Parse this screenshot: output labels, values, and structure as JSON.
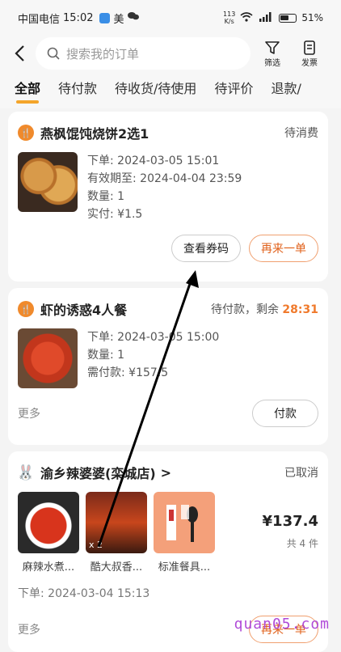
{
  "status_bar": {
    "carrier": "中国电信",
    "time": "15:02",
    "app_badge": "美",
    "net_speed_top": "113",
    "net_speed_bottom": "K/s",
    "battery": "51%"
  },
  "header": {
    "search_placeholder": "搜索我的订单",
    "filter_label": "筛选",
    "invoice_label": "发票"
  },
  "tabs": [
    {
      "label": "全部",
      "active": true
    },
    {
      "label": "待付款"
    },
    {
      "label": "待收货/待使用"
    },
    {
      "label": "待评价"
    },
    {
      "label": "退款/"
    }
  ],
  "orders": [
    {
      "shop": "燕枫馄饨烧饼2选1",
      "status": "待消费",
      "lines": [
        "下单: 2024-03-05 15:01",
        "有效期至: 2024-04-04 23:59",
        "数量: 1",
        "实付: ¥1.5"
      ],
      "buttons": [
        "查看券码",
        "再来一单"
      ]
    },
    {
      "shop": "虾的诱惑4人餐",
      "status_prefix": "待付款，剩余 ",
      "countdown": "28:31",
      "lines": [
        "下单: 2024-03-05 15:00",
        "数量: 1",
        "需付款: ¥157.5"
      ],
      "more": "更多",
      "buttons": [
        "付款"
      ]
    },
    {
      "shop": "渝乡辣婆婆(栾城店)",
      "chevron": ">",
      "status": "已取消",
      "items": [
        {
          "name": "麻辣水煮...",
          "qty": ""
        },
        {
          "name": "酷大叔香...",
          "qty": "x 2"
        },
        {
          "name": "标准餐具..."
        }
      ],
      "price": "¥137.4",
      "count": "共 4 件",
      "order_time": "下单: 2024-03-04 15:13",
      "more": "更多",
      "buttons": [
        "再来一单"
      ]
    }
  ],
  "watermark": "quan05.com"
}
